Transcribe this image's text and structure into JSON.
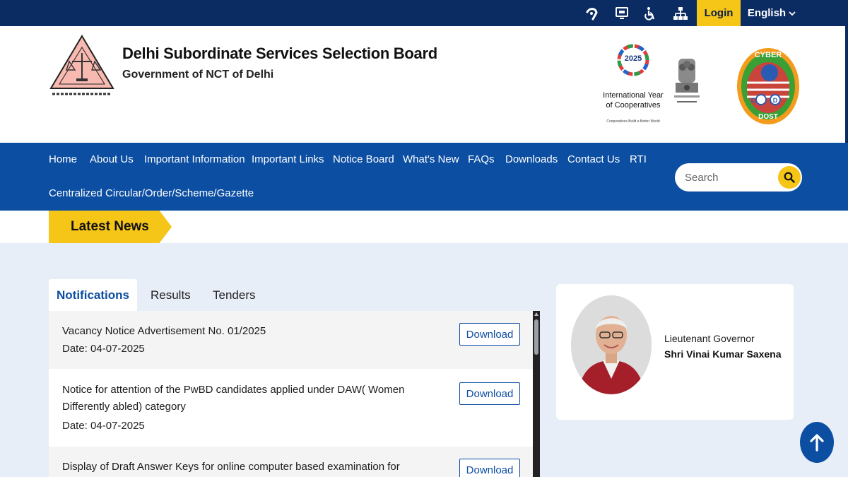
{
  "topbar": {
    "icons": [
      "screen-reader-icon",
      "skip-to-content-icon",
      "accessibility-icon",
      "sitemap-icon"
    ],
    "login_label": "Login",
    "language": "English"
  },
  "header": {
    "title": "Delhi Subordinate Services Selection Board",
    "subtitle": "Government of NCT of Delhi",
    "iyc": {
      "year": "2025",
      "line1": "International Year",
      "line2": "of Cooperatives",
      "tagline": "Cooperatives Build a Better World"
    },
    "cyber": {
      "top": "CYBER",
      "mid": "C D",
      "bottom": "DOST"
    }
  },
  "nav": {
    "items": [
      "Home",
      "About Us",
      "Important Information",
      "Important Links",
      "Notice Board",
      "What's New",
      "FAQs",
      "Downloads",
      "Contact Us",
      "RTI",
      "Centralized Circular/Order/Scheme/Gazette"
    ],
    "search_placeholder": "Search"
  },
  "news": {
    "tag": "Latest News"
  },
  "tabs": [
    "Notifications",
    "Results",
    "Tenders"
  ],
  "notifications": [
    {
      "title": "Vacancy Notice Advertisement No. 01/2025",
      "date": "Date: 04-07-2025",
      "action": "Download"
    },
    {
      "title": "Notice for attention of the PwBD candidates applied under DAW( Women Differently abled) category",
      "date": "Date: 04-07-2025",
      "action": "Download"
    },
    {
      "title": "Display of Draft Answer Keys for online computer based examination for various",
      "date": "",
      "action": "Download"
    }
  ],
  "lg": {
    "role": "Lieutenant Governor",
    "name": "Shri Vinai Kumar Saxena"
  },
  "colors": {
    "topbar": "#0b2b63",
    "nav": "#0c4ea2",
    "accent": "#f5c518",
    "page_bg": "#e8eef8"
  }
}
